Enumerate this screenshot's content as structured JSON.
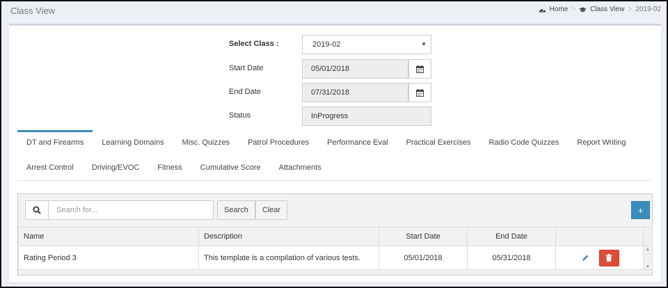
{
  "header": {
    "title": "Class View",
    "breadcrumb": {
      "home": "Home",
      "section": "Class View",
      "current": "2019-02"
    }
  },
  "form": {
    "select_class_label": "Select Class :",
    "select_class_value": "2019-02",
    "start_date_label": "Start Date",
    "start_date_value": "05/01/2018",
    "end_date_label": "End Date",
    "end_date_value": "07/31/2018",
    "status_label": "Status",
    "status_value": "InProgress"
  },
  "tabs": {
    "row1": [
      "DT and Firearms",
      "Learning Domains",
      "Misc. Quizzes",
      "Patrol Procedures",
      "Performance Eval",
      "Practical Exercises",
      "Radio Code Quizzes",
      "Report Writing"
    ],
    "row2": [
      "Arrest Control",
      "Driving/EVOC",
      "Fitness",
      "Cumulative Score",
      "Attachments"
    ],
    "active": "DT and Firearms"
  },
  "grid": {
    "search_placeholder": "Search for...",
    "search_label": "Search",
    "clear_label": "Clear",
    "add_label": "+",
    "columns": [
      "Name",
      "Description",
      "Start Date",
      "End Date"
    ],
    "rows": [
      {
        "name": "Rating Period 3",
        "description": "This template is a compilation of various tests.",
        "start": "05/01/2018",
        "end": "05/31/2018"
      }
    ]
  },
  "colors": {
    "accent": "#3c8dbc",
    "danger": "#dd4b39"
  }
}
